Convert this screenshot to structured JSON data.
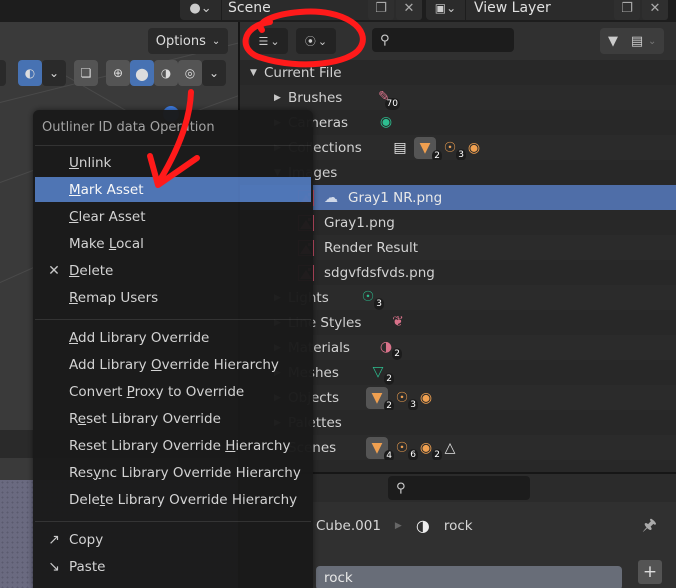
{
  "header": {
    "scene_label": "Scene",
    "view_layer_label": "View Layer"
  },
  "viewport": {
    "options_label": "Options",
    "shading_modes": [
      "wireframe",
      "solid",
      "material-preview",
      "rendered"
    ],
    "active_shading": "solid"
  },
  "outliner": {
    "display_mode_icon": "outliner-tree-icon",
    "blender_file_icon": "blender-icon",
    "search_placeholder": "",
    "rows": [
      {
        "label": "Current File",
        "level": 0,
        "expanded": true
      },
      {
        "label": "Brushes",
        "level": 1,
        "expanded": false,
        "badges": [
          {
            "icon": "brush-icon",
            "count": "70",
            "color": "#d8728a"
          }
        ]
      },
      {
        "label": "Cameras",
        "level": 1,
        "expanded": false,
        "badges": [
          {
            "icon": "camera-data-icon",
            "color": "#2dbd8f"
          }
        ]
      },
      {
        "label": "Collections",
        "level": 1,
        "expanded": false,
        "badges": [
          {
            "icon": "collection-box-icon",
            "color": "#e8e8e8"
          },
          {
            "icon": "mesh-object-icon",
            "count": "2",
            "color": "#f0a050"
          },
          {
            "icon": "light-object-icon",
            "count": "3",
            "color": "#f0a050"
          },
          {
            "icon": "camera-object-icon",
            "color": "#f0a050"
          }
        ]
      },
      {
        "label": "Images",
        "level": 1,
        "expanded": true
      },
      {
        "label": "Gray1 NR.png",
        "level": 2,
        "selected": true,
        "image": true,
        "extra_icon": "fake-user-icon"
      },
      {
        "label": "Gray1.png",
        "level": 2,
        "image": true
      },
      {
        "label": "Render Result",
        "level": 2,
        "image": true
      },
      {
        "label": "sdgvfdsfvds.png",
        "level": 2,
        "image": true
      },
      {
        "label": "Lights",
        "level": 1,
        "expanded": false,
        "badges": [
          {
            "icon": "light-data-icon",
            "count": "3",
            "color": "#2dbd8f"
          }
        ]
      },
      {
        "label": "Line Styles",
        "level": 1,
        "expanded": false,
        "badges": [
          {
            "icon": "line-style-icon",
            "color": "#d8728a"
          }
        ]
      },
      {
        "label": "Materials",
        "level": 1,
        "expanded": false,
        "badges": [
          {
            "icon": "material-icon",
            "count": "2",
            "color": "#d8728a"
          }
        ]
      },
      {
        "label": "Meshes",
        "level": 1,
        "expanded": false,
        "badges": [
          {
            "icon": "mesh-data-icon",
            "count": "2",
            "color": "#2dbd8f"
          }
        ]
      },
      {
        "label": "Objects",
        "level": 1,
        "expanded": false,
        "badges": [
          {
            "icon": "mesh-object-icon",
            "count": "2",
            "color": "#f0a050"
          },
          {
            "icon": "light-object-icon",
            "count": "3",
            "color": "#f0a050"
          },
          {
            "icon": "camera-object-icon",
            "color": "#f0a050"
          }
        ]
      },
      {
        "label": "Palettes",
        "level": 1,
        "expanded": false
      },
      {
        "label": "Scenes",
        "level": 1,
        "expanded": false,
        "badges": [
          {
            "icon": "mesh-object-icon",
            "count": "4",
            "color": "#f0a050"
          },
          {
            "icon": "light-object-icon",
            "count": "6",
            "color": "#f0a050"
          },
          {
            "icon": "camera-object-icon",
            "count": "2",
            "color": "#f0a050"
          },
          {
            "icon": "scene-icon",
            "color": "#e0e0e0"
          }
        ]
      }
    ]
  },
  "context_menu": {
    "title": "Outliner ID data Operation",
    "groups": [
      [
        {
          "label": "Unlink",
          "underline": "U"
        },
        {
          "label": "Mark Asset",
          "underline": "M",
          "active": true
        },
        {
          "label": "Clear Asset",
          "underline": "C"
        },
        {
          "label": "Make Local",
          "underline": "L"
        },
        {
          "label": "Delete",
          "underline": "D",
          "icon": "x-icon"
        },
        {
          "label": "Remap Users",
          "underline": "R"
        }
      ],
      [
        {
          "label": "Add Library Override",
          "underline": "A"
        },
        {
          "label": "Add Library Override Hierarchy",
          "underline": "O"
        },
        {
          "label": "Convert Proxy to Override",
          "underline": "P"
        },
        {
          "label": "Reset Library Override",
          "underline": "e"
        },
        {
          "label": "Reset Library Override Hierarchy",
          "underline": "H"
        },
        {
          "label": "Resync Library Override Hierarchy",
          "underline": "y"
        },
        {
          "label": "Delete Library Override Hierarchy",
          "underline": "t"
        }
      ],
      [
        {
          "label": "Copy",
          "icon": "copy-icon"
        },
        {
          "label": "Paste",
          "icon": "paste-icon"
        }
      ]
    ]
  },
  "properties": {
    "search_placeholder": "",
    "breadcrumb_object": "Cube.001",
    "breadcrumb_material": "rock",
    "material_slot": "rock",
    "add_slot_label": "+"
  },
  "annotation_color": "#ff1a1a"
}
